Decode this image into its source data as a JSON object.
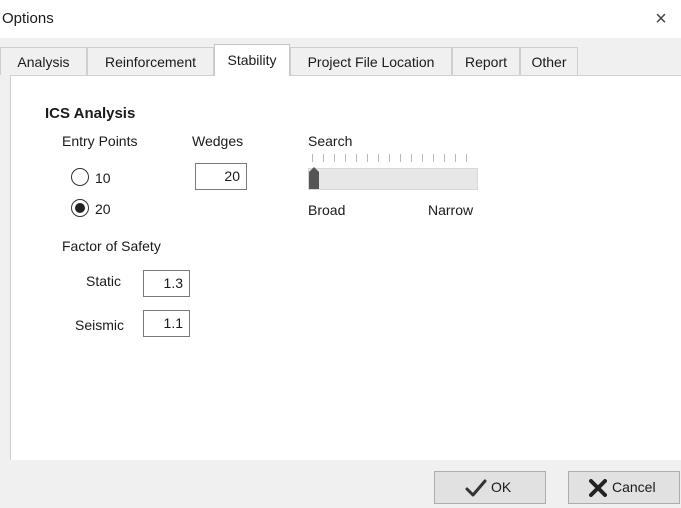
{
  "window": {
    "title": "Options",
    "close_symbol": "×"
  },
  "tabs": [
    {
      "label": "Analysis",
      "selected": false
    },
    {
      "label": "Reinforcement",
      "selected": false
    },
    {
      "label": "Stability",
      "selected": true
    },
    {
      "label": "Project File Location",
      "selected": false
    },
    {
      "label": "Report",
      "selected": false
    },
    {
      "label": "Other",
      "selected": false
    }
  ],
  "ics": {
    "title": "ICS Analysis",
    "entry_points": {
      "label": "Entry Points",
      "options": [
        {
          "label": "10",
          "checked": false
        },
        {
          "label": "20",
          "checked": true
        }
      ]
    },
    "wedges": {
      "label": "Wedges",
      "value": "20"
    },
    "search": {
      "label": "Search",
      "min_label": "Broad",
      "max_label": "Narrow",
      "level": 0
    },
    "factor_of_safety": {
      "label": "Factor of Safety",
      "static": {
        "label": "Static",
        "value": "1.3"
      },
      "seismic": {
        "label": "Seismic",
        "value": "1.1"
      }
    }
  },
  "buttons": {
    "ok": {
      "label": "OK",
      "icon": "checkmark-icon"
    },
    "cancel": {
      "label": "Cancel",
      "icon": "x-icon"
    }
  }
}
